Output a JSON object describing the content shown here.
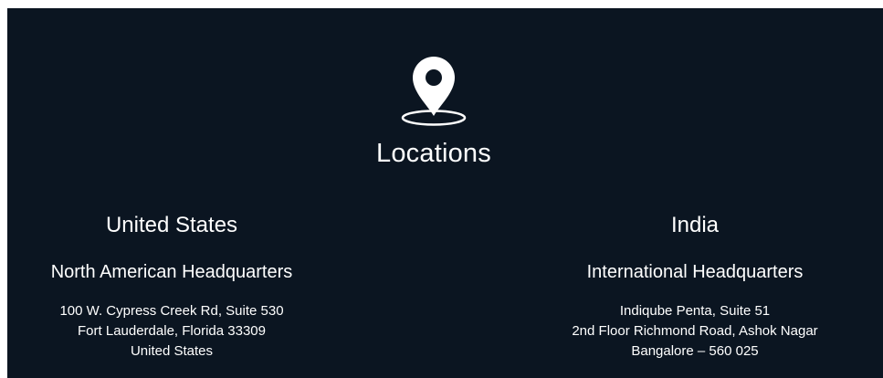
{
  "icons": {
    "location": "map-pin-icon"
  },
  "colors": {
    "background": "#0b1521",
    "text": "#ffffff"
  },
  "section": {
    "title": "Locations"
  },
  "locations": [
    {
      "country": "United States",
      "headquarters": "North American Headquarters",
      "address": [
        "100 W. Cypress Creek Rd, Suite 530",
        "Fort Lauderdale, Florida 33309",
        "United States"
      ]
    },
    {
      "country": "India",
      "headquarters": "International Headquarters",
      "address": [
        "Indiqube Penta, Suite 51",
        "2nd Floor Richmond Road, Ashok Nagar",
        "Bangalore – 560 025"
      ]
    }
  ]
}
